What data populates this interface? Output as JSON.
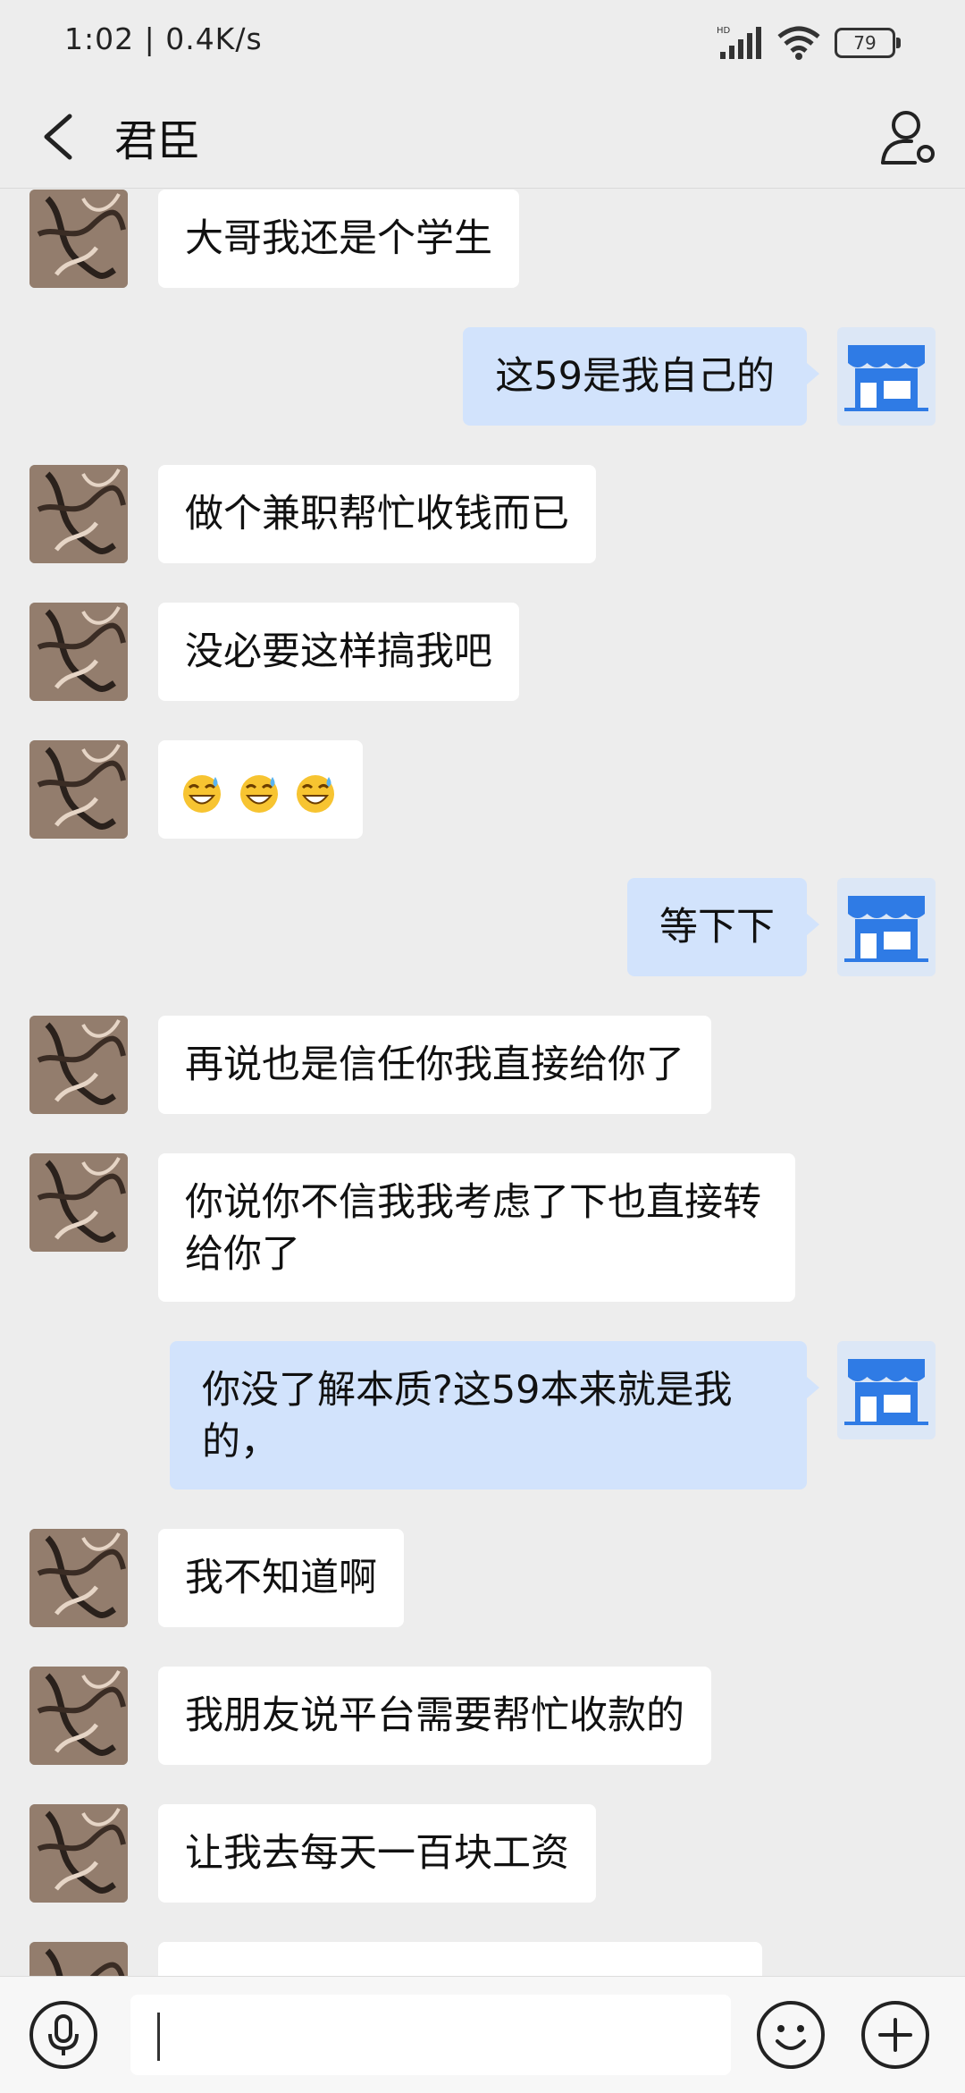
{
  "status": {
    "time": "1:02 | 0.4K/s",
    "network": "HD",
    "battery": "79"
  },
  "header": {
    "title": "君臣",
    "back_icon": "chevron-left-icon",
    "profile_icon": "person-icon"
  },
  "colors": {
    "background": "#EDEDED",
    "incoming_bubble": "#FFFFFF",
    "outgoing_bubble": "#D2E3FC",
    "shop_avatar": "#2F7BE5"
  },
  "messages": [
    {
      "side": "left",
      "text": "大哥我还是个学生"
    },
    {
      "side": "right",
      "text": "这59是我自己的"
    },
    {
      "side": "left",
      "text": "做个兼职帮忙收钱而已"
    },
    {
      "side": "left",
      "text": "没必要这样搞我吧"
    },
    {
      "side": "left",
      "text": "",
      "emoji_count": 3,
      "emoji": "sweat-grin-emoji"
    },
    {
      "side": "right",
      "text": "等下下"
    },
    {
      "side": "left",
      "text": "再说也是信任你我直接给你了"
    },
    {
      "side": "left",
      "text": "你说你不信我我考虑了下也直接转给你了"
    },
    {
      "side": "right",
      "text": "你没了解本质?这59本来就是我的，"
    },
    {
      "side": "left",
      "text": "我不知道啊"
    },
    {
      "side": "left",
      "text": "我朋友说平台需要帮忙收款的"
    },
    {
      "side": "left",
      "text": "让我去每天一百块工资"
    }
  ],
  "composer": {
    "input_value": "",
    "voice_icon": "microphone-icon",
    "emoji_icon": "smiley-icon",
    "plus_icon": "plus-icon"
  }
}
